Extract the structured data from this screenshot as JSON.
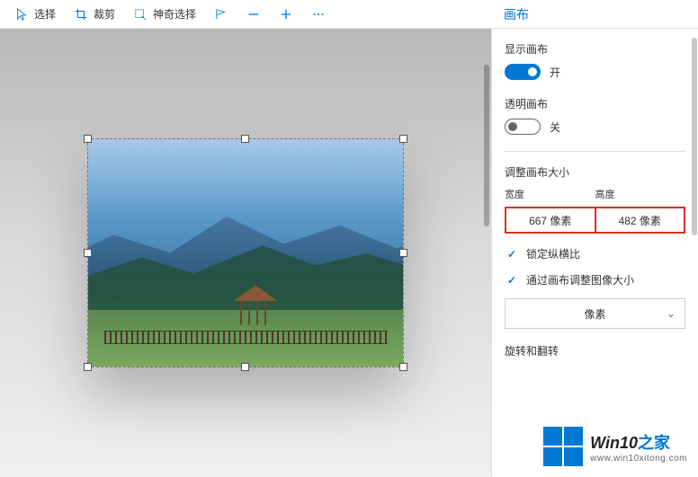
{
  "toolbar": {
    "select": "选择",
    "crop": "裁剪",
    "magic": "神奇选择",
    "panel_title": "画布"
  },
  "panel": {
    "show_canvas_label": "显示画布",
    "show_canvas_state": "开",
    "transparent_label": "透明画布",
    "transparent_state": "关",
    "resize_heading": "调整画布大小",
    "width_label": "宽度",
    "height_label": "高度",
    "width_value": "667 像素",
    "height_value": "482 像素",
    "lock_aspect": "锁定纵横比",
    "resize_image": "通过画布调整图像大小",
    "unit": "像素",
    "rotate_heading": "旋转和翻转"
  },
  "watermark": {
    "title_en": "Win10",
    "title_zh": "之家",
    "url": "www.win10xitong.com"
  }
}
